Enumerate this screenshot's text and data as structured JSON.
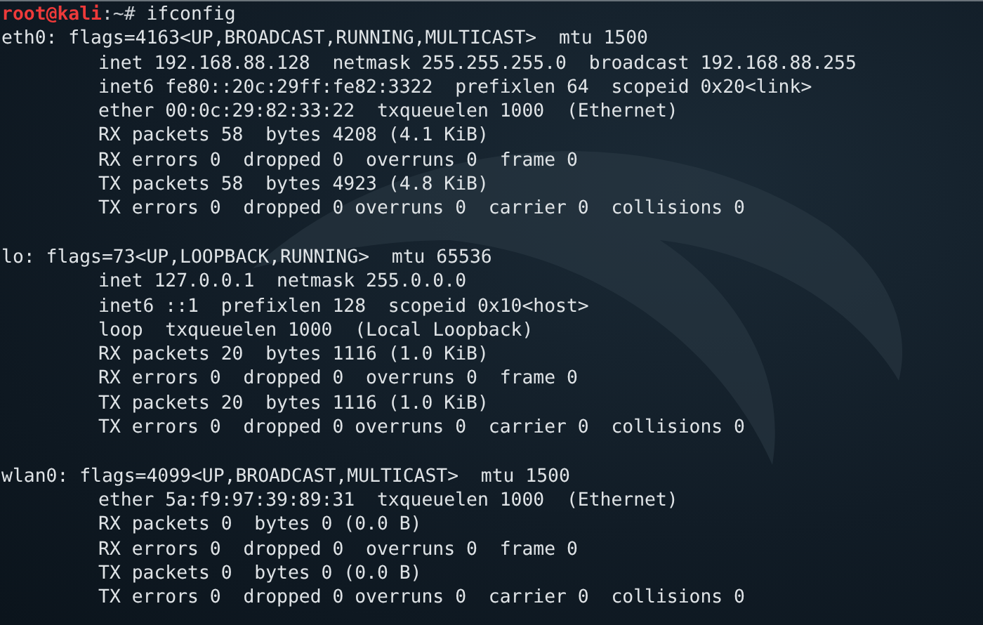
{
  "prompt": {
    "user_host": "root@kali",
    "path": ":~#",
    "command": "ifconfig"
  },
  "interfaces": [
    {
      "header": "eth0: flags=4163<UP,BROADCAST,RUNNING,MULTICAST>  mtu 1500",
      "lines": [
        "inet 192.168.88.128  netmask 255.255.255.0  broadcast 192.168.88.255",
        "inet6 fe80::20c:29ff:fe82:3322  prefixlen 64  scopeid 0x20<link>",
        "ether 00:0c:29:82:33:22  txqueuelen 1000  (Ethernet)",
        "RX packets 58  bytes 4208 (4.1 KiB)",
        "RX errors 0  dropped 0  overruns 0  frame 0",
        "TX packets 58  bytes 4923 (4.8 KiB)",
        "TX errors 0  dropped 0 overruns 0  carrier 0  collisions 0"
      ]
    },
    {
      "header": "lo: flags=73<UP,LOOPBACK,RUNNING>  mtu 65536",
      "lines": [
        "inet 127.0.0.1  netmask 255.0.0.0",
        "inet6 ::1  prefixlen 128  scopeid 0x10<host>",
        "loop  txqueuelen 1000  (Local Loopback)",
        "RX packets 20  bytes 1116 (1.0 KiB)",
        "RX errors 0  dropped 0  overruns 0  frame 0",
        "TX packets 20  bytes 1116 (1.0 KiB)",
        "TX errors 0  dropped 0 overruns 0  carrier 0  collisions 0"
      ]
    },
    {
      "header": "wlan0: flags=4099<UP,BROADCAST,MULTICAST>  mtu 1500",
      "lines": [
        "ether 5a:f9:97:39:89:31  txqueuelen 1000  (Ethernet)",
        "RX packets 0  bytes 0 (0.0 B)",
        "RX errors 0  dropped 0  overruns 0  frame 0",
        "TX packets 0  bytes 0 (0.0 B)",
        "TX errors 0  dropped 0 overruns 0  carrier 0  collisions 0"
      ]
    }
  ]
}
